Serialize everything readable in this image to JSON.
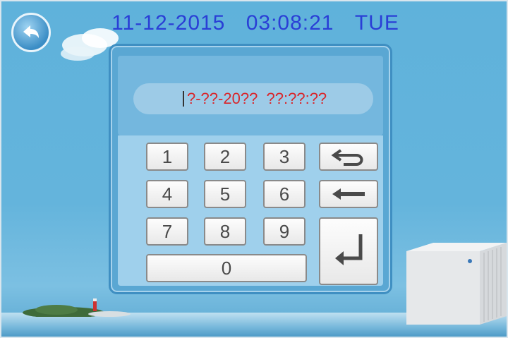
{
  "header": {
    "date": "11-12-2015",
    "time": "03:08:21",
    "weekday": "TUE"
  },
  "display": {
    "value": "?-??-20??  ??:??:??"
  },
  "keypad": {
    "keys": [
      "1",
      "2",
      "3",
      "4",
      "5",
      "6",
      "7",
      "8",
      "9",
      "0"
    ]
  },
  "icons": {
    "back": "back-arrow-icon",
    "undo": "undo-icon",
    "backspace": "backspace-arrow-icon",
    "enter": "enter-icon"
  },
  "colors": {
    "datetime": "#2a3fd6",
    "display_text": "#d9262b",
    "background": "#64b4dc"
  }
}
